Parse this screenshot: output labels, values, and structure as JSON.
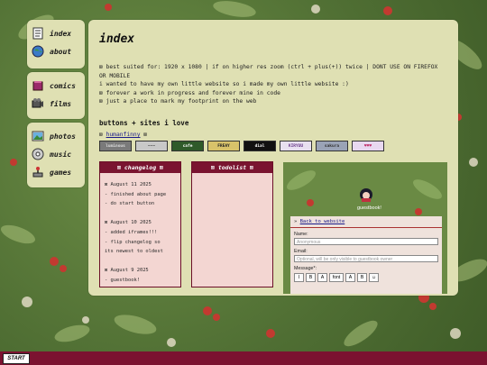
{
  "nav": {
    "group1": [
      {
        "label": "index",
        "icon": "document-icon"
      },
      {
        "label": "about",
        "icon": "globe-icon"
      }
    ],
    "group2": [
      {
        "label": "comics",
        "icon": "book-icon"
      },
      {
        "label": "films",
        "icon": "film-icon"
      }
    ],
    "group3": [
      {
        "label": "photos",
        "icon": "picture-icon"
      },
      {
        "label": "music",
        "icon": "music-icon"
      },
      {
        "label": "games",
        "icon": "joystick-icon"
      }
    ]
  },
  "main": {
    "title": "index",
    "intro": [
      "⊠ best suited for: 1920 x 1080 | if on higher res zoom (ctrl + plus(+)) twice | DONT USE ON FIREFOX",
      "OR MOBILE",
      "i wanted to have my own little website so i made my own little website :)",
      "⊠ forever a work in progress and forever mine in code",
      "⊠ just a place to mark my footprint on the web"
    ],
    "buttons_title": "buttons + sites i love",
    "link_prefix": "⊠ ",
    "link_text": "humanfinny",
    "link_suffix": " ⊠",
    "site_buttons": [
      {
        "label": "luminous",
        "bg": "#7a7a7a",
        "fg": "#dddddd"
      },
      {
        "label": "~~~",
        "bg": "#c8c8c8",
        "fg": "#333333"
      },
      {
        "label": "cafe",
        "bg": "#2f5a2a",
        "fg": "#ffffff"
      },
      {
        "label": "FREAY",
        "bg": "#d8c26a",
        "fg": "#222222"
      },
      {
        "label": "dial",
        "bg": "#111111",
        "fg": "#ffffff"
      },
      {
        "label": "KIRYUU",
        "bg": "#e8e0f0",
        "fg": "#6a3a8a"
      },
      {
        "label": "sakura",
        "bg": "#9aa3b6",
        "fg": "#333333"
      },
      {
        "label": "♥♥♥",
        "bg": "#e8d8f0",
        "fg": "#c0306a"
      }
    ]
  },
  "changelog": {
    "title": "⊠ changelog ⊠",
    "lines": [
      "⊠ August 11 2025",
      "- finished about page",
      "- do start button",
      "",
      "⊠ August 10 2025",
      "- added iframes!!!",
      "- flip changelog so",
      "its newest to oldest",
      "",
      "⊠ August 9 2025",
      "- guestbook!"
    ]
  },
  "todolist": {
    "title": "⊠ todolist ⊠",
    "lines": []
  },
  "guestbook": {
    "caption": "guestbook!",
    "back_prefix": "» ",
    "back_link": "Back to website",
    "name_label": "Name:",
    "name_placeholder": "Anonymous",
    "email_label": "Email:",
    "email_placeholder": "Optional, will be only visible to guestbook owner",
    "message_label": "Message*:",
    "tools": [
      "I",
      "B",
      "A",
      "font",
      "A",
      "B",
      "☺"
    ]
  },
  "taskbar": {
    "start_label": "START"
  }
}
